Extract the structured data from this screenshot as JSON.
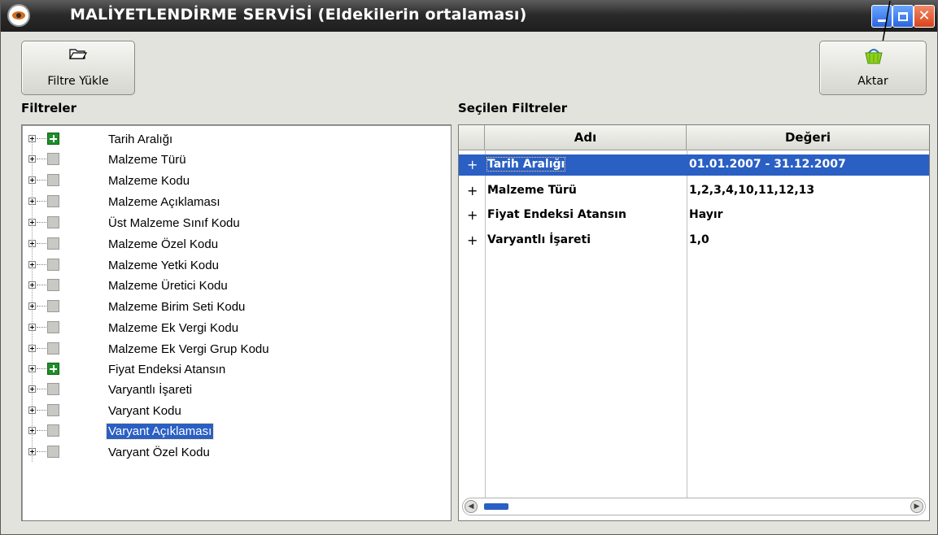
{
  "window": {
    "title": "MALİYETLENDİRME SERVİSİ (Eldekilerin ortalaması)",
    "controls": {
      "minimize": "minimize",
      "maximize": "maximize",
      "close": "close"
    }
  },
  "toolbar": {
    "filtre_yukle_label": "Filtre Yükle",
    "aktar_label": "Aktar"
  },
  "filters_panel": {
    "title": "Filtreler",
    "items": [
      {
        "label": "Tarih Aralığı",
        "checked": true
      },
      {
        "label": "Malzeme Türü",
        "checked": false
      },
      {
        "label": "Malzeme Kodu",
        "checked": false
      },
      {
        "label": "Malzeme Açıklaması",
        "checked": false
      },
      {
        "label": "Üst Malzeme Sınıf Kodu",
        "checked": false
      },
      {
        "label": "Malzeme Özel Kodu",
        "checked": false
      },
      {
        "label": "Malzeme Yetki Kodu",
        "checked": false
      },
      {
        "label": "Malzeme Üretici Kodu",
        "checked": false
      },
      {
        "label": "Malzeme Birim Seti Kodu",
        "checked": false
      },
      {
        "label": "Malzeme Ek Vergi Kodu",
        "checked": false
      },
      {
        "label": "Malzeme Ek Vergi Grup Kodu",
        "checked": false
      },
      {
        "label": "Fiyat Endeksi Atansın",
        "checked": true
      },
      {
        "label": "Varyantlı İşareti",
        "checked": false
      },
      {
        "label": "Varyant Kodu",
        "checked": false
      },
      {
        "label": "Varyant Açıklaması",
        "checked": false,
        "selected": true
      },
      {
        "label": "Varyant Özel Kodu",
        "checked": false
      }
    ]
  },
  "selected_panel": {
    "title": "Seçilen Filtreler",
    "columns": [
      "Adı",
      "Değeri"
    ],
    "rows": [
      {
        "expander": "+",
        "name": "Tarih Aralığı",
        "value": "01.01.2007 - 31.12.2007",
        "selected": true
      },
      {
        "expander": "+",
        "name": "Malzeme Türü",
        "value": "1,2,3,4,10,11,12,13"
      },
      {
        "expander": "+",
        "name": "Fiyat Endeksi Atansın",
        "value": "Hayır"
      },
      {
        "expander": "+",
        "name": "Varyantlı İşareti",
        "value": "1,0"
      }
    ]
  },
  "colors": {
    "selection": "#2a5fc4",
    "checked_box": "#1f8f2a",
    "titlebar": "#2a2a2a",
    "window_bg": "#e3e3de"
  }
}
